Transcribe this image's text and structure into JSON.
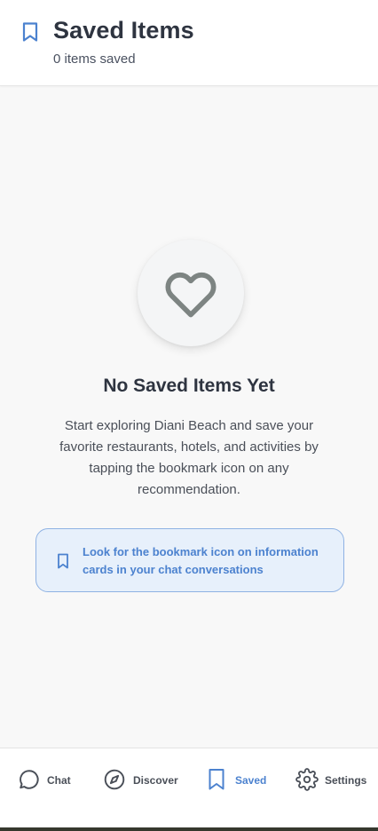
{
  "header": {
    "title": "Saved Items",
    "subtitle": "0 items saved",
    "icon": "bookmark-icon"
  },
  "empty_state": {
    "icon": "heart-icon",
    "title": "No Saved Items Yet",
    "description": "Start exploring Diani Beach and save your favorite restaurants, hotels, and activities by tapping the bookmark icon on any recommendation."
  },
  "tip": {
    "icon": "bookmark-icon",
    "text": "Look for the bookmark icon on information cards in your chat conversations"
  },
  "nav": {
    "items": [
      {
        "label": "Chat",
        "icon": "chat-bubble-icon",
        "active": false
      },
      {
        "label": "Discover",
        "icon": "compass-icon",
        "active": false
      },
      {
        "label": "Saved",
        "icon": "bookmark-icon",
        "active": true
      },
      {
        "label": "Settings",
        "icon": "gear-icon",
        "active": false
      }
    ]
  },
  "colors": {
    "accent": "#4c82cf",
    "text": "#2e3440",
    "muted": "#4a4f58",
    "background": "#f8f8f8",
    "tip_background": "#e7f0fb"
  }
}
